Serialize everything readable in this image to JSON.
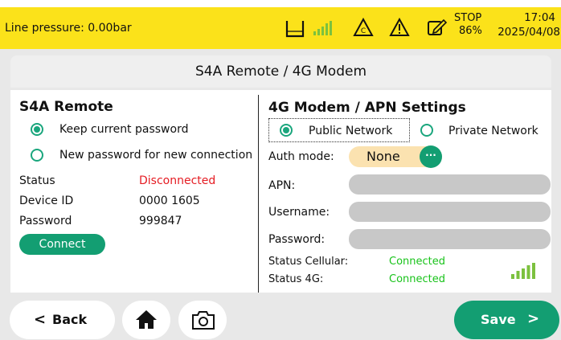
{
  "status_bar": {
    "line_pressure": "Line pressure: 0.00bar",
    "stop_label": "STOP",
    "stop_percent": "86%",
    "time": "17:04",
    "date": "2025/04/08"
  },
  "page": {
    "title": "S4A Remote / 4G Modem"
  },
  "remote": {
    "heading": "S4A Remote",
    "option_keep": "Keep current password",
    "option_new": "New password for new connection",
    "status_label": "Status",
    "status_value": "Disconnected",
    "device_id_label": "Device ID",
    "device_id_value": "0000 1605",
    "password_label": "Password",
    "password_value": "999847",
    "connect_label": "Connect"
  },
  "modem": {
    "heading": "4G Modem / APN Settings",
    "public_network": "Public Network",
    "private_network": "Private Network",
    "auth_mode_label": "Auth mode:",
    "auth_mode_value": "None",
    "auth_more": "···",
    "apn_label": "APN:",
    "username_label": "Username:",
    "password_label": "Password:",
    "apn_value": "",
    "username_value": "",
    "password_value": "",
    "status_cellular_label": "Status Cellular:",
    "status_cellular_value": "Connected",
    "status_4g_label": "Status 4G:",
    "status_4g_value": "Connected"
  },
  "footer": {
    "back_label": "Back",
    "save_label": "Save"
  },
  "colors": {
    "status_bar": "#fbe21a",
    "accent_green": "#139e72",
    "disconnected_red": "#e51c23",
    "connected_green": "#18c31a"
  },
  "icons": [
    "tank-icon",
    "signal-icon",
    "c-warning-icon",
    "warning-icon",
    "edit-icon",
    "home-icon",
    "camera-icon"
  ]
}
